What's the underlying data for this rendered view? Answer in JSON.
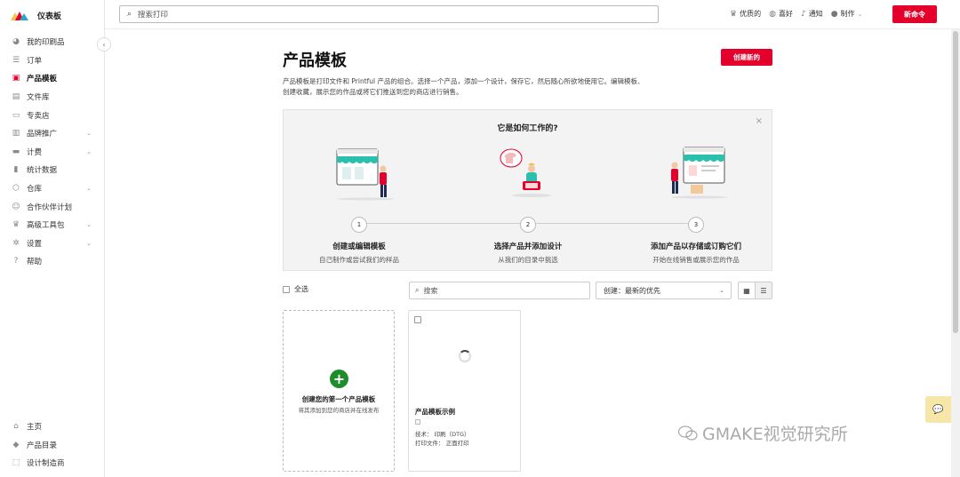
{
  "sidebar": {
    "brand": "仪表板",
    "items": [
      {
        "label": "我的印刷品",
        "icon": "pie-chart-icon",
        "has_chevron": false
      },
      {
        "label": "订单",
        "icon": "list-icon",
        "has_chevron": false
      },
      {
        "label": "产品模板",
        "icon": "template-icon",
        "has_chevron": false,
        "active": true
      },
      {
        "label": "文件库",
        "icon": "image-icon",
        "has_chevron": false
      },
      {
        "label": "专卖店",
        "icon": "store-icon",
        "has_chevron": false
      },
      {
        "label": "品牌推广",
        "icon": "tag-icon",
        "has_chevron": true
      },
      {
        "label": "计费",
        "icon": "card-icon",
        "has_chevron": true
      },
      {
        "label": "统计数据",
        "icon": "bar-chart-icon",
        "has_chevron": false
      },
      {
        "label": "仓库",
        "icon": "box-icon",
        "has_chevron": true
      },
      {
        "label": "合作伙伴计划",
        "icon": "users-icon",
        "has_chevron": false
      },
      {
        "label": "高级工具包",
        "icon": "crown-icon",
        "has_chevron": true
      },
      {
        "label": "设置",
        "icon": "gear-icon",
        "has_chevron": true
      },
      {
        "label": "帮助",
        "icon": "help-icon",
        "has_chevron": false
      }
    ],
    "bottom_items": [
      {
        "label": "主页",
        "icon": "home-icon"
      },
      {
        "label": "产品目录",
        "icon": "shirt-icon"
      },
      {
        "label": "设计制造商",
        "icon": "design-icon"
      }
    ]
  },
  "topbar": {
    "search_placeholder": "搜索打印",
    "actions": [
      {
        "label": "优质的",
        "icon": "crown-icon"
      },
      {
        "label": "喜好",
        "icon": "globe-icon"
      },
      {
        "label": "通知",
        "icon": "bell-icon"
      },
      {
        "label": "制作",
        "icon": "user-icon"
      }
    ],
    "new_order_label": "新命令"
  },
  "main": {
    "title": "产品模板",
    "create_new_label": "创建新的",
    "description": "产品模板是打印文件和 Printful 产品的组合。选择一个产品，添加一个设计，保存它，然后随心所欲地使用它。编辑模板、创建收藏，展示您的作品或将它们推送到您的商店进行销售。",
    "how_it_works": {
      "title": "它是如何工作的?",
      "steps": [
        {
          "num": "1",
          "title": "创建或编辑模板",
          "sub": "自己制作或尝试我们的样品"
        },
        {
          "num": "2",
          "title": "选择产品并添加设计",
          "sub": "从我们的目录中挑选"
        },
        {
          "num": "3",
          "title": "添加产品以存储或订购它们",
          "sub": "开始在线销售或展示您的作品"
        }
      ]
    },
    "filters": {
      "select_all": "全选",
      "search_placeholder": "搜索",
      "sort_value": "创建：最新的优先"
    },
    "create_card": {
      "title": "创建您的第一个产品模板",
      "sub": "将其添加到您的商店并在线发布"
    },
    "template_card": {
      "name": "产品模板示例",
      "tech": "技术： 印刷（DTG）",
      "print_file": "打印文件： 正面打印"
    }
  },
  "watermark": "GMAKE视觉研究所",
  "colors": {
    "accent": "#e4002b",
    "create_green": "#1e8c2c",
    "chat_button": "#f6e6a8"
  }
}
